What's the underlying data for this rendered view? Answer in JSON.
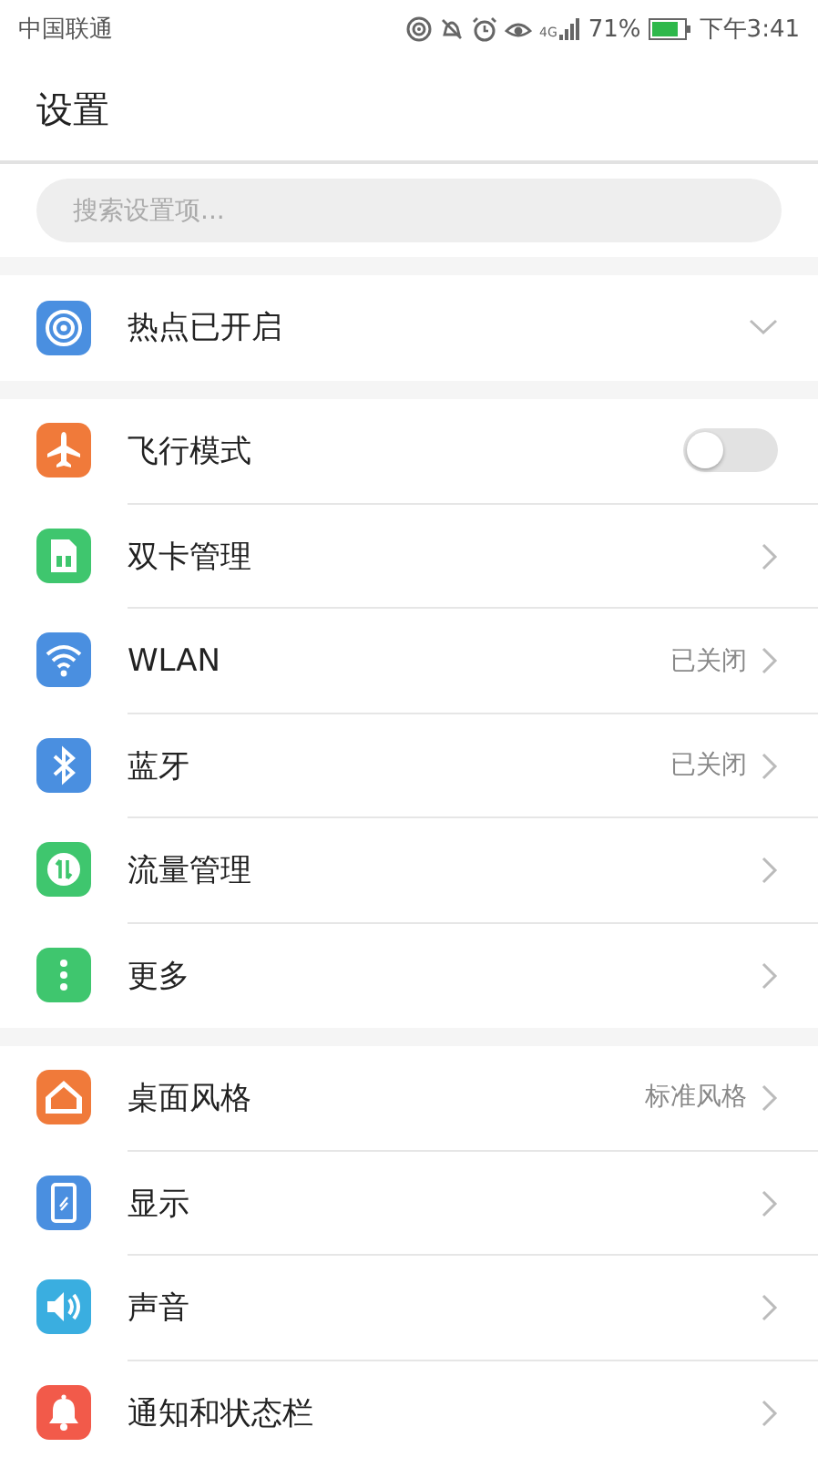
{
  "status_bar": {
    "carrier": "中国联通",
    "network": "4G",
    "battery": "71%",
    "time": "下午3:41"
  },
  "header": {
    "title": "设置"
  },
  "search": {
    "placeholder": "搜索设置项..."
  },
  "groups": [
    {
      "items": [
        {
          "label": "热点已开启",
          "kind": "expand",
          "color": "#4a8fe0"
        }
      ]
    },
    {
      "items": [
        {
          "label": "飞行模式",
          "kind": "toggle",
          "on": false,
          "color": "#f07a3a"
        },
        {
          "label": "双卡管理",
          "kind": "chevron",
          "color": "#3fc66e"
        },
        {
          "label": "WLAN",
          "kind": "chevron",
          "value": "已关闭",
          "color": "#4a8fe0"
        },
        {
          "label": "蓝牙",
          "kind": "chevron",
          "value": "已关闭",
          "color": "#4a8fe0"
        },
        {
          "label": "流量管理",
          "kind": "chevron",
          "color": "#3fc66e"
        },
        {
          "label": "更多",
          "kind": "chevron",
          "color": "#3fc66e"
        }
      ]
    },
    {
      "items": [
        {
          "label": "桌面风格",
          "kind": "chevron",
          "value": "标准风格",
          "color": "#f07a3a"
        },
        {
          "label": "显示",
          "kind": "chevron",
          "color": "#4a8fe0"
        },
        {
          "label": "声音",
          "kind": "chevron",
          "color": "#3aaee0"
        },
        {
          "label": "通知和状态栏",
          "kind": "chevron",
          "color": "#f25a4a"
        }
      ]
    }
  ]
}
